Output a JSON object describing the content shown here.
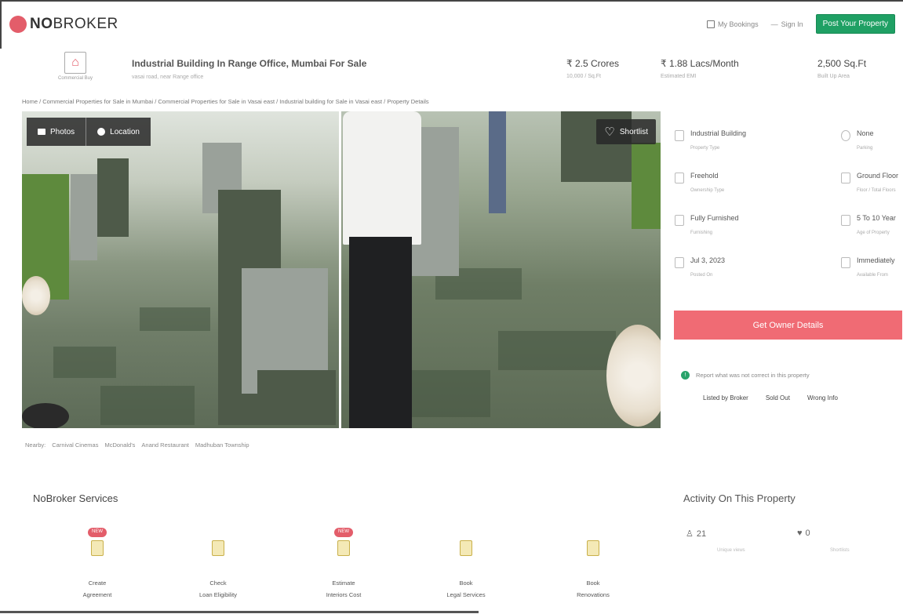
{
  "nav": {
    "logo_bold": "NO",
    "logo_rest": "BROKER",
    "my_bookings": "My Bookings",
    "sign_in": "Sign In",
    "post_property": "Post Your Property"
  },
  "header": {
    "category_label": "Commercial Buy",
    "title": "Industrial Building In Range Office, Mumbai For Sale",
    "subtitle": "vasai road, near Range office",
    "price": "₹ 2.5 Crores",
    "price_sub": "10,000 / Sq.Ft",
    "emi": "₹ 1.88 Lacs/Month",
    "emi_sub": "Estimated EMI",
    "area": "2,500 Sq.Ft",
    "area_sub": "Built Up Area"
  },
  "breadcrumb": "Home  /  Commercial Properties for Sale in Mumbai  /  Commercial Properties for Sale in Vasai east  /  Industrial building for Sale in Vasai east  /  Property Details",
  "photos": {
    "photos_label": "Photos",
    "location_label": "Location",
    "shortlist_label": "Shortlist"
  },
  "details": [
    {
      "value": "Industrial Building",
      "label": "Property Type"
    },
    {
      "value": "None",
      "label": "Parking"
    },
    {
      "value": "Freehold",
      "label": "Ownership Type"
    },
    {
      "value": "Ground Floor",
      "label": "Floor / Total Floors"
    },
    {
      "value": "Fully Furnished",
      "label": "Furnishing"
    },
    {
      "value": "5 To 10 Year",
      "label": "Age of Property"
    },
    {
      "value": "Jul 3, 2023",
      "label": "Posted On"
    },
    {
      "value": "Immediately",
      "label": "Available From"
    }
  ],
  "owner_button": "Get Owner Details",
  "report": {
    "text": "Report what was not correct in this property",
    "options": [
      "Listed by Broker",
      "Sold Out",
      "Wrong Info"
    ]
  },
  "nearby": {
    "label": "Nearby:",
    "items": [
      "Carnival Cinemas",
      "McDonald's",
      "Anand Restaurant",
      "Madhuban Township"
    ]
  },
  "services": {
    "title": "NoBroker Services",
    "items": [
      {
        "badge": "NEW",
        "line1": "Create",
        "line2": "Agreement"
      },
      {
        "badge": "",
        "line1": "Check",
        "line2": "Loan Eligibility"
      },
      {
        "badge": "NEW",
        "line1": "Estimate",
        "line2": "Interiors Cost"
      },
      {
        "badge": "",
        "line1": "Book",
        "line2": "Legal Services"
      },
      {
        "badge": "",
        "line1": "Book",
        "line2": "Renovations"
      }
    ]
  },
  "activity": {
    "title": "Activity On This Property",
    "views": "21",
    "views_label": "Unique views",
    "shortlists": "0",
    "shortlists_label": "Shortlists"
  }
}
